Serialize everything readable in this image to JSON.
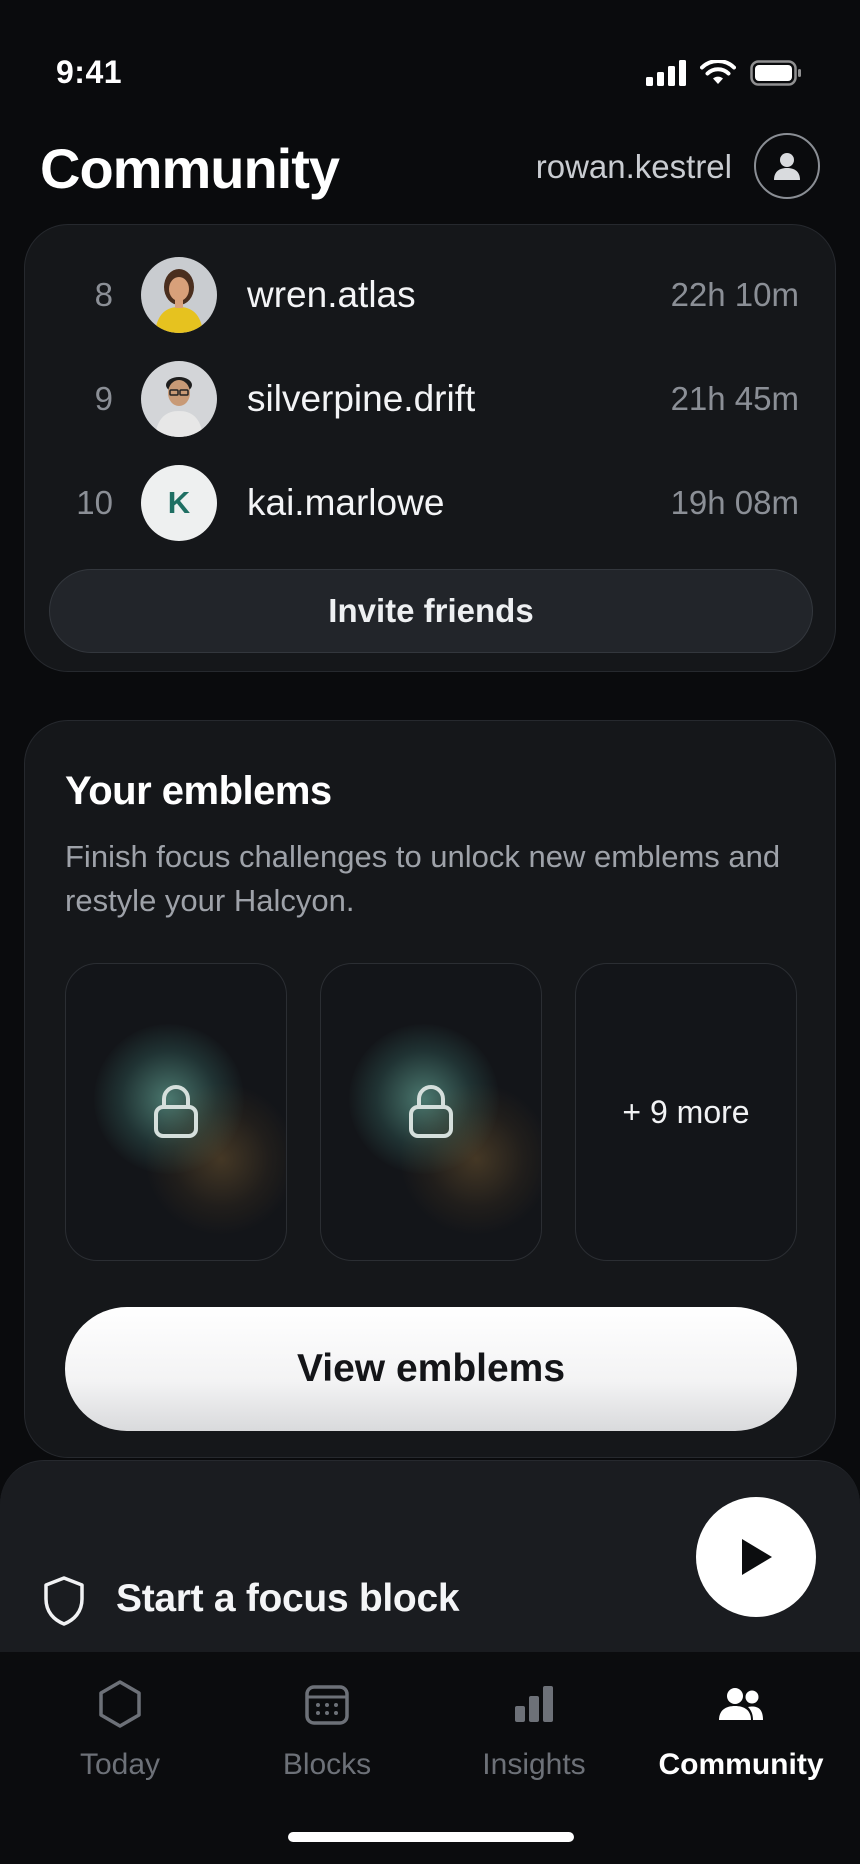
{
  "status": {
    "time": "9:41"
  },
  "header": {
    "title": "Community",
    "username": "rowan.kestrel"
  },
  "leaderboard": {
    "rows": [
      {
        "rank": "8",
        "name": "wren.atlas",
        "time": "22h 10m",
        "avatar": "photo-woman-yellow"
      },
      {
        "rank": "9",
        "name": "silverpine.drift",
        "time": "21h 45m",
        "avatar": "photo-man-glasses"
      },
      {
        "rank": "10",
        "name": "kai.marlowe",
        "time": "19h 08m",
        "avatar": "initial",
        "initial": "K"
      }
    ],
    "invite_label": "Invite friends"
  },
  "emblems": {
    "title": "Your emblems",
    "description": "Finish focus challenges to unlock new emblems and restyle your Halcyon.",
    "tiles": [
      {
        "state": "locked",
        "icon": "lock-icon"
      },
      {
        "state": "locked",
        "icon": "lock-icon"
      }
    ],
    "more_label": "+ 9 more",
    "view_label": "View emblems"
  },
  "focus": {
    "label": "Start a focus block",
    "icon": "shield-icon",
    "action_icon": "play-icon"
  },
  "tabs": [
    {
      "label": "Today",
      "icon": "hexagon-icon",
      "active": false
    },
    {
      "label": "Blocks",
      "icon": "calendar-icon",
      "active": false
    },
    {
      "label": "Insights",
      "icon": "bar-chart-icon",
      "active": false
    },
    {
      "label": "Community",
      "icon": "people-icon",
      "active": true
    }
  ],
  "colors": {
    "background": "#0a0b0d",
    "card": "#15171a",
    "accent_teal": "#1f6f63",
    "muted": "#8b8f96"
  }
}
